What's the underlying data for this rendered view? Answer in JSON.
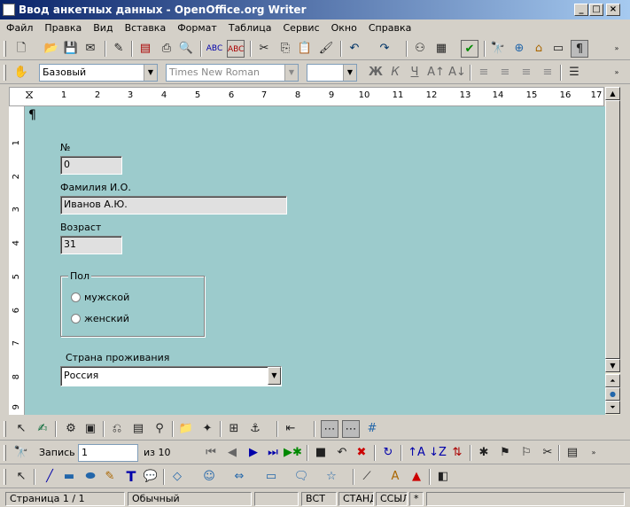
{
  "window": {
    "title": "Ввод анкетных данных - OpenOffice.org Writer"
  },
  "menu": [
    "Файл",
    "Правка",
    "Вид",
    "Вставка",
    "Формат",
    "Таблица",
    "Сервис",
    "Окно",
    "Справка"
  ],
  "formatting": {
    "style": "Базовый",
    "font": "Times New Roman",
    "size": "",
    "bold": "Ж",
    "italic": "К",
    "underline": "Ч"
  },
  "ruler": {
    "marks": [
      "1",
      "2",
      "3",
      "4",
      "5",
      "6",
      "7",
      "8",
      "9",
      "10",
      "11",
      "12",
      "13",
      "14",
      "15",
      "16",
      "17"
    ],
    "vmarks": [
      "1",
      "2",
      "3",
      "4",
      "5",
      "6",
      "7",
      "8",
      "9"
    ]
  },
  "form": {
    "pilcrow": "¶",
    "number_label": "№",
    "number_value": "0",
    "name_label": "Фамилия И.О.",
    "name_value": "Иванов А.Ю.",
    "age_label": "Возраст",
    "age_value": "31",
    "gender_group": "Пол",
    "gender_male": "мужской",
    "gender_female": "женский",
    "country_label": "Страна проживания",
    "country_value": "Россия"
  },
  "navigation": {
    "record_label": "Запись",
    "record_value": "1",
    "of_label": "из 10"
  },
  "statusbar": {
    "page": "Страница  1 / 1",
    "style": "Обычный",
    "mode1": "ВСТ",
    "mode2": "СТАНД",
    "mode3": "ССЫЛ",
    "modified": "*"
  }
}
